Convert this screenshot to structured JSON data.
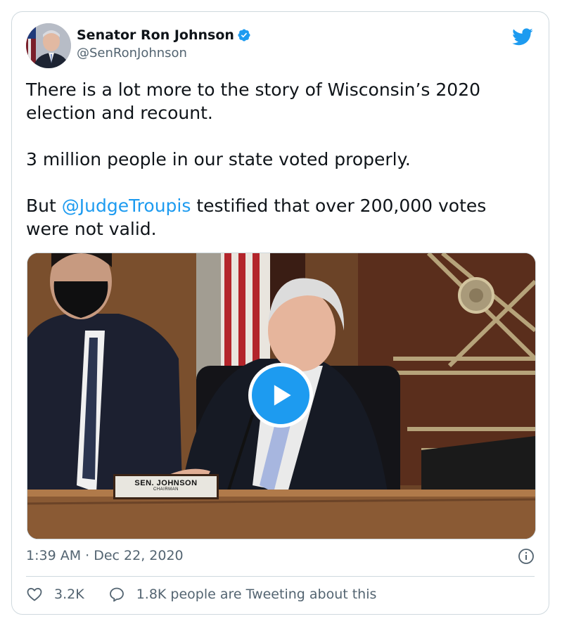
{
  "tweet": {
    "author_name": "Senator Ron Johnson",
    "handle": "@SenRonJohnson",
    "verified": true,
    "text_line1": "There is a lot more to the story of Wisconsin’s 2020 election and recount.",
    "text_line2": "3 million people in our state voted properly.",
    "text_line3_prefix": "But ",
    "text_line3_mention": "@JudgeTroupis",
    "text_line3_suffix": " testified that over 200,000 votes were not valid.",
    "timestamp": "1:39 AM · Dec 22, 2020",
    "like_count": "3.2K",
    "reply_text": "1.8K people are Tweeting about this"
  },
  "media": {
    "nameplate_name": "SEN. JOHNSON",
    "nameplate_title": "CHAIRMAN"
  },
  "icons": {
    "verified": "verified-badge-icon",
    "brand": "twitter-bird-icon",
    "play": "play-icon",
    "info": "info-icon",
    "like": "heart-icon",
    "reply": "speech-bubble-icon"
  },
  "colors": {
    "accent": "#1d9bf0",
    "text": "#0f1419",
    "secondary": "#536471",
    "border": "#cfd9de"
  }
}
